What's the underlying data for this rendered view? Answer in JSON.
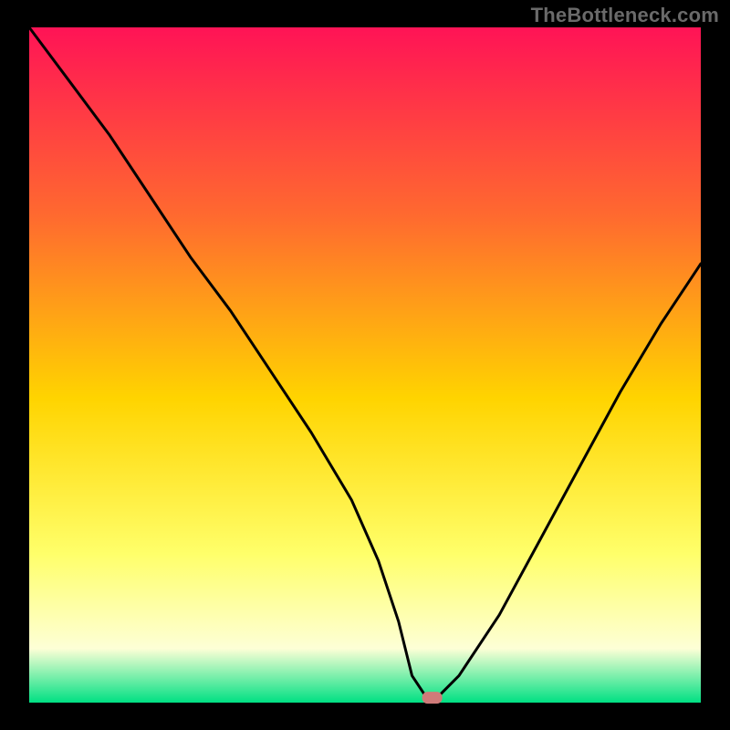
{
  "watermark": "TheBottleneck.com",
  "colors": {
    "frame": "#000000",
    "curve": "#000000",
    "marker": "#cf7a79",
    "grad_top": "#ff1356",
    "grad_mid_upper": "#ff6a2f",
    "grad_mid": "#ffd400",
    "grad_mid_lower": "#ffff6a",
    "grad_pale": "#fdffd6",
    "grad_green": "#00e083"
  },
  "chart_data": {
    "type": "line",
    "title": "",
    "xlabel": "",
    "ylabel": "",
    "xlim": [
      0,
      100
    ],
    "ylim": [
      0,
      100
    ],
    "series": [
      {
        "name": "bottleneck-curve",
        "x": [
          0,
          6,
          12,
          18,
          24,
          30,
          36,
          42,
          48,
          52,
          55,
          57,
          59,
          61,
          64,
          70,
          76,
          82,
          88,
          94,
          100
        ],
        "y": [
          100,
          92,
          84,
          75,
          66,
          58,
          49,
          40,
          30,
          21,
          12,
          4,
          1,
          1,
          4,
          13,
          24,
          35,
          46,
          56,
          65
        ]
      }
    ],
    "marker": {
      "x": 60,
      "y": 0.8
    },
    "annotations": []
  }
}
